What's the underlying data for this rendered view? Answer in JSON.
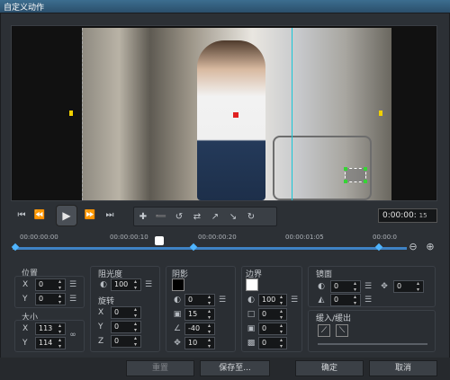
{
  "window": {
    "title": "自定义动作"
  },
  "transport": {
    "timecode": "0:00:00:",
    "timecode_frame": "15"
  },
  "ruler": {
    "ticks": [
      "00:00:00:00",
      "00:00:00:10",
      "00:00:00:20",
      "00:00:01:05",
      "00:00:0"
    ]
  },
  "position": {
    "label": "位置",
    "x_label": "X",
    "x": "0",
    "y_label": "Y",
    "y": "0"
  },
  "size": {
    "label": "大小",
    "x_label": "X",
    "x": "113",
    "y_label": "Y",
    "y": "114"
  },
  "opacity": {
    "label": "阻光度",
    "value": "100"
  },
  "rotation": {
    "label": "旋转",
    "x_label": "X",
    "x": "0",
    "y_label": "Y",
    "y": "0",
    "z_label": "Z",
    "z": "0"
  },
  "shadow": {
    "label": "阴影",
    "opacity": "0",
    "blur": "15",
    "angle": "-40",
    "distance": "10"
  },
  "border": {
    "label": "边界",
    "opacity": "100",
    "width": "0",
    "blur": "0",
    "offset": "0"
  },
  "mirror": {
    "label": "镜面",
    "opacity": "0",
    "blur": "0",
    "offset": "0"
  },
  "fade": {
    "label": "缓入/缓出"
  },
  "footer": {
    "reset": "重置",
    "save": "保存至...",
    "ok": "确定",
    "cancel": "取消"
  },
  "colors": {
    "accent": "#3e82c4",
    "track_keyframe": "#4fb4ff",
    "shadow_color": "#000000",
    "border_color": "#ffffff"
  }
}
